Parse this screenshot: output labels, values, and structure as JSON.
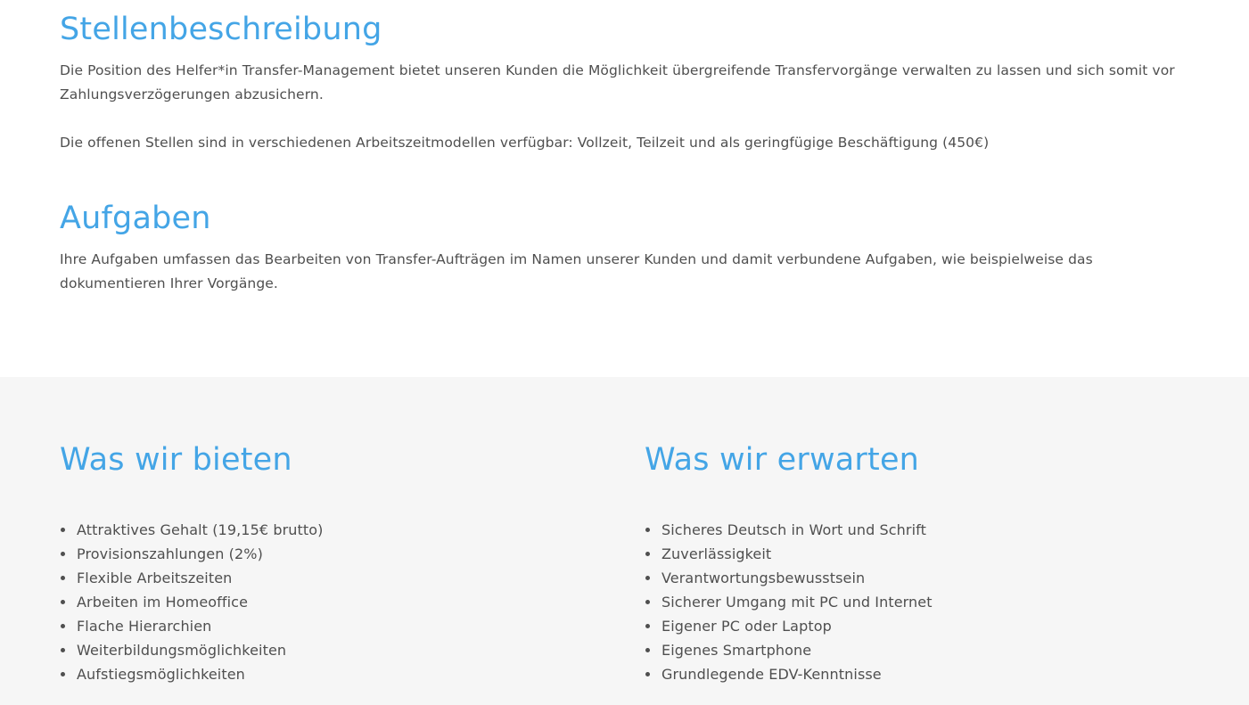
{
  "description": {
    "heading": "Stellenbeschreibung",
    "paragraph1": "Die Position des Helfer*in Transfer-Management bietet unseren Kunden die Möglichkeit übergreifende Transfervorgänge verwalten zu lassen und sich somit vor Zahlungsverzögerungen abzusichern.",
    "paragraph2": "Die offenen Stellen sind in verschiedenen Arbeitszeitmodellen verfügbar: Vollzeit, Teilzeit und als geringfügige Beschäftigung (450€)"
  },
  "tasks": {
    "heading": "Aufgaben",
    "paragraph": "Ihre Aufgaben umfassen das Bearbeiten von Transfer-Aufträgen im Namen unserer Kunden und damit verbundene Aufgaben, wie beispielweise das dokumentieren Ihrer Vorgänge."
  },
  "offer": {
    "heading": "Was wir bieten",
    "items": [
      "Attraktives Gehalt (19,15€ brutto)",
      "Provisionszahlungen (2%)",
      "Flexible Arbeitszeiten",
      "Arbeiten im Homeoffice",
      "Flache Hierarchien",
      "Weiterbildungsmöglichkeiten",
      "Aufstiegsmöglichkeiten"
    ]
  },
  "expect": {
    "heading": "Was wir erwarten",
    "items": [
      "Sicheres Deutsch in Wort und Schrift",
      "Zuverlässigkeit",
      "Verantwortungsbewusstsein",
      "Sicherer Umgang mit PC und Internet",
      "Eigener PC oder Laptop",
      "Eigenes Smartphone",
      "Grundlegende EDV-Kenntnisse"
    ]
  },
  "colors": {
    "heading": "#44a5e6",
    "text": "#4f4f4f",
    "section_background": "#f6f6f6"
  }
}
